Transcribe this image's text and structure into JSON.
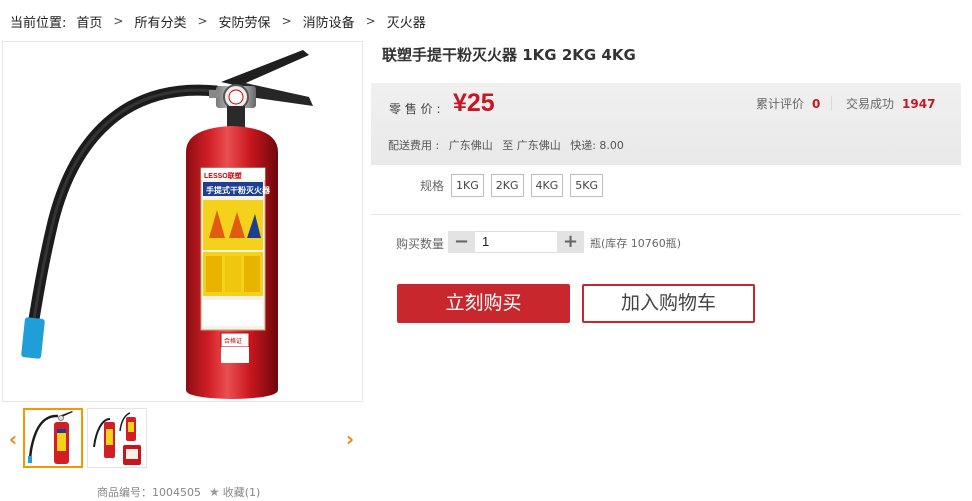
{
  "breadcrumb": {
    "label": "当前位置:",
    "separator": ">",
    "items": [
      "首页",
      "所有分类",
      "安防劳保",
      "消防设备",
      "灭火器"
    ]
  },
  "product": {
    "title": "联塑手提干粉灭火器 1KG 2KG 4KG",
    "image_icon": "fire-extinguisher-photo",
    "extinguisher_label_brand": "LESSO联塑",
    "extinguisher_label_title": "手提式干粉灭火器",
    "extinguisher_label_cert": "合格证"
  },
  "price": {
    "label": "零 售 价 :",
    "value": "¥25",
    "review_label": "累计评价",
    "review_count": "0",
    "sales_label": "交易成功",
    "sales_count": "1947"
  },
  "shipping": {
    "label": "配送费用 :",
    "from": "广东佛山",
    "to": "至 广东佛山",
    "express": "快递: 8.00"
  },
  "spec": {
    "label": "规格",
    "options": [
      "1KG",
      "2KG",
      "4KG",
      "5KG"
    ]
  },
  "quantity": {
    "label": "购买数量",
    "minus": "−",
    "value": "1",
    "plus": "+",
    "stock_text": "瓶(库存 10760瓶)"
  },
  "actions": {
    "buy_now": "立刻购买",
    "add_to_cart": "加入购物车"
  },
  "thumbnails": {
    "prev": "‹",
    "next": "›"
  },
  "meta": {
    "product_code": "商品编号：1004505",
    "favorite_icon": "★",
    "favorite": "收藏(1)"
  },
  "colors": {
    "accent_red": "#c8282d",
    "price_red": "#c81623",
    "thumb_border": "#f39800"
  }
}
